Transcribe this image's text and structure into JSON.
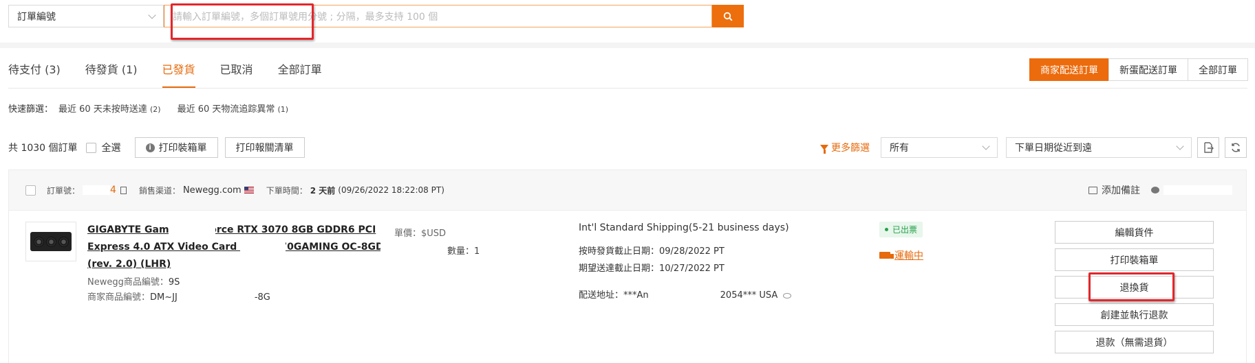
{
  "search": {
    "type_label": "訂單編號",
    "placeholder": "請輸入訂單編號，多個訂單號用分號 ; 分隔，最多支持 100 個"
  },
  "tabs": [
    {
      "label": "待支付 (3)"
    },
    {
      "label": "待發貨 (1)"
    },
    {
      "label": "已發貨",
      "active": true
    },
    {
      "label": "已取消"
    },
    {
      "label": "全部訂單"
    }
  ],
  "scope_tabs": [
    {
      "label": "商家配送訂單",
      "active": true
    },
    {
      "label": "新蛋配送訂單"
    },
    {
      "label": "全部訂單"
    }
  ],
  "quick_filter": {
    "label": "快速篩選：",
    "options": [
      {
        "text": "最近 60 天未按時送達",
        "count": "(2)"
      },
      {
        "text": "最近 60 天物流追踪異常",
        "count": "(1)"
      }
    ]
  },
  "toolbar": {
    "count_text": "共 1030 個訂單",
    "select_all": "全選",
    "print_box_label": "打印裝箱單",
    "print_customs_label": "打印報關清單",
    "more_filter": "更多篩選",
    "filter_value": "所有",
    "sort_value": "下單日期從近到遠"
  },
  "order": {
    "order_no_label": "訂單號：",
    "order_no_partial": "4",
    "channel_label": "銷售渠道：",
    "channel": "Newegg.com",
    "time_label": "下單時間：",
    "time_rel": "2 天前",
    "time_abs": "(09/26/2022 18:22:08 PT)",
    "add_note": "添加備註",
    "product": {
      "title": "GIGABYTE Gaming GeForce RTX 3070 8GB GDDR6 PCI Express 4.0 ATX Video Card GV-N3070GAMING OC-8GD (rev. 2.0) (LHR)",
      "newegg_no_label": "Newegg商品編號：",
      "newegg_no": "9S",
      "seller_no_label": "商家商品編號：",
      "seller_no_start": "DM~JJ",
      "seller_no_end": "-8G",
      "unit_price": "單價：$USD",
      "quantity": "數量：1"
    },
    "shipping": {
      "method": "Int'l Standard Shipping(5-21 business days)",
      "ship_by": "按時發貨截止日期：09/28/2022 PT",
      "deliver_by": "期望送達截止日期：10/27/2022 PT",
      "addr_label": "配送地址：",
      "addr_start": "***An",
      "addr_end": "2054*** USA"
    },
    "status_badge": "已出票",
    "transit": "運輸中",
    "actions": [
      "編輯貨件",
      "打印裝箱單",
      "退換貨",
      "創建並執行退款",
      "退款（無需退貨）"
    ]
  },
  "colors": {
    "accent": "#ec6b0c",
    "highlight": "#e3262b",
    "success": "#25a04a"
  }
}
